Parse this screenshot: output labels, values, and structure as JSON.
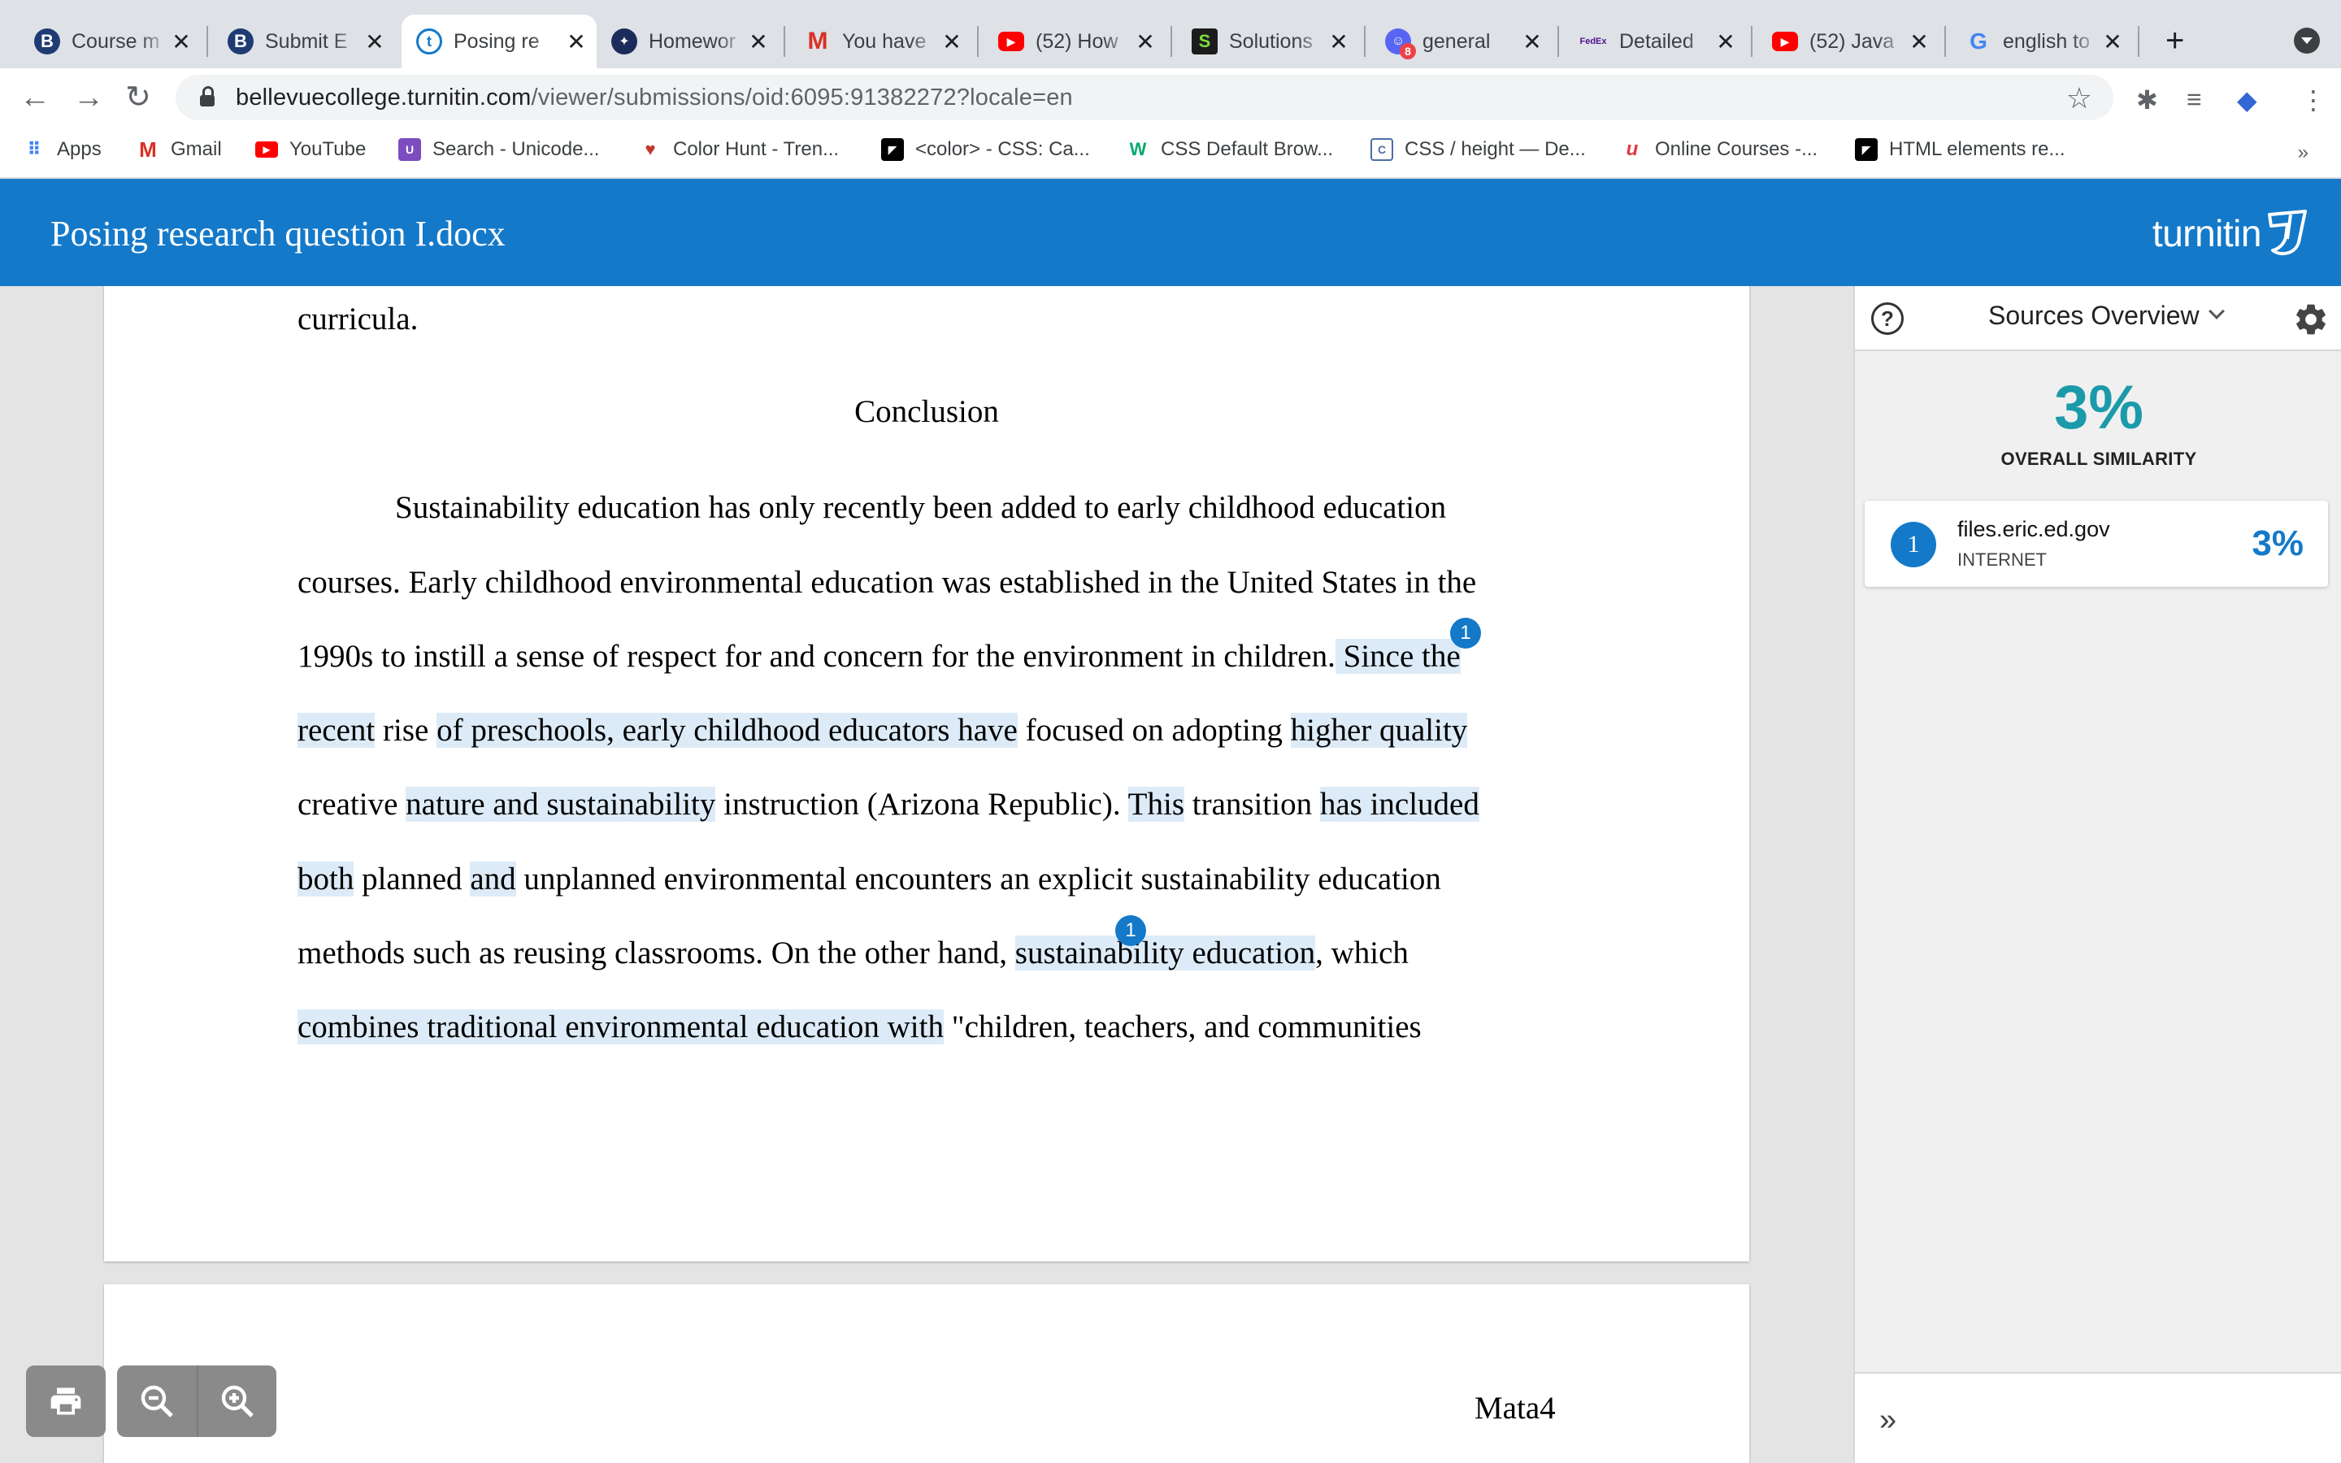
{
  "browser": {
    "tabs": [
      {
        "title": "Course m",
        "icon": "bellevue-b-icon"
      },
      {
        "title": "Submit E",
        "icon": "bellevue-b-icon"
      },
      {
        "title": "Posing re",
        "icon": "turnitin-icon"
      },
      {
        "title": "Homewor",
        "icon": "chegg-icon"
      },
      {
        "title": "You have",
        "icon": "gmail-icon"
      },
      {
        "title": "(52) How",
        "icon": "youtube-icon"
      },
      {
        "title": "Solutions",
        "icon": "s-icon"
      },
      {
        "title": "general",
        "icon": "discord-icon"
      },
      {
        "title": "Detailed",
        "icon": "fedex-icon"
      },
      {
        "title": "(52) Java",
        "icon": "youtube-icon"
      },
      {
        "title": "english to",
        "icon": "google-icon"
      }
    ],
    "url_host": "bellevuecollege.turnitin.com",
    "url_path": "/viewer/submissions/oid:6095:91382272?locale=en",
    "bookmarks": [
      {
        "label": "Apps"
      },
      {
        "label": "Gmail"
      },
      {
        "label": "YouTube"
      },
      {
        "label": "Search - Unicode..."
      },
      {
        "label": "Color Hunt - Tren..."
      },
      {
        "label": "<color> - CSS: Ca..."
      },
      {
        "label": "CSS Default Brow..."
      },
      {
        "label": "CSS / height — De..."
      },
      {
        "label": "Online Courses -..."
      },
      {
        "label": "HTML elements re..."
      }
    ],
    "bookmarks_more": "»",
    "discord_badge": "8",
    "fedex_label": "FedEx"
  },
  "header": {
    "doc_title": "Posing research question I.docx",
    "brand": "turnitin"
  },
  "document": {
    "line_0": "curricula.",
    "heading": "Conclusion",
    "l1": "Sustainability education has only recently been added to early childhood education",
    "l2": "courses. Early childhood environmental education was established in the United States in the",
    "l3a": "1990s to instill a sense of respect for and concern for the environment in children.",
    "l3b": " Since the",
    "l4a": "recent",
    "l4b": " rise ",
    "l4c": "of preschools, early childhood educators have",
    "l4d": " focused on adopting ",
    "l4e": "higher quality",
    "l5a": "creative ",
    "l5b": "nature and sustainability",
    "l5c": " instruction (Arizona Republic). ",
    "l5d": "This",
    "l5e": " transition ",
    "l5f": "has included",
    "l6a": "both",
    "l6b": " planned ",
    "l6c": "and",
    "l6d": " unplanned environmental encounters an explicit sustainability education",
    "l7a": "methods such as reusing classrooms. On the other hand, ",
    "l7b": "sustainability education",
    "l7c": ", which",
    "l8a": "combines traditional environmental education with",
    "l8b": " \"children, teachers, and communities",
    "page2_header": "Mata4",
    "match_marker": "1"
  },
  "sidebar": {
    "title": "Sources Overview",
    "overall_pct": "3%",
    "overall_label": "OVERALL SIMILARITY",
    "sources": [
      {
        "num": "1",
        "name": "files.eric.ed.gov",
        "type": "INTERNET",
        "pct": "3%"
      }
    ],
    "expand_glyph": "»"
  },
  "colors": {
    "turnitin_blue": "#1479c9",
    "similarity_teal": "#1b9aaa",
    "highlight": "#dcebf7"
  }
}
